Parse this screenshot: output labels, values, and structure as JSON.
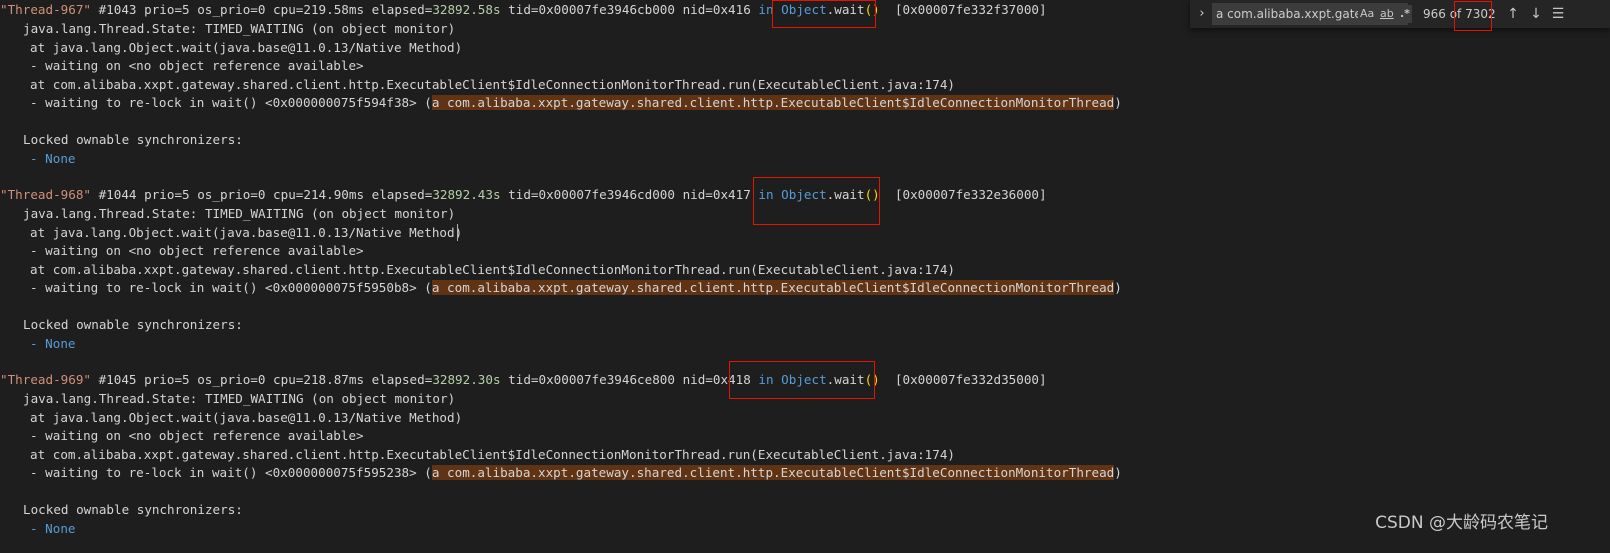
{
  "find_widget": {
    "query": "a com.alibaba.xxpt.gatew",
    "match_case_label": "Aa",
    "whole_word_label": "ab",
    "regex_label": ".*",
    "match_count": "966 of 7302",
    "toggle_icon": "chevron-right-icon",
    "prev_icon": "arrow-up-icon",
    "next_icon": "arrow-down-icon",
    "selection_icon": "find-in-selection-icon"
  },
  "watermark": "CSDN @大龄码农笔记",
  "colors": {
    "background": "#1e1e1e",
    "text": "#d4d4d4",
    "string": "#ce9178",
    "keyword": "#569cd6",
    "number": "#b5cea8",
    "paren": "#ffd700",
    "find_highlight": "#613315",
    "annotation_box": "#e51400"
  },
  "threads": [
    {
      "name": "\"Thread-967\"",
      "num": "#1043",
      "prio": "prio=5",
      "os_prio": "os_prio=0",
      "cpu": "cpu=219.58ms",
      "elapsed_label": "elapsed=",
      "elapsed_value": "32892.58s",
      "tid": "tid=0x00007fe3946cb000",
      "nid": "nid=0x416",
      "in_kw": "in",
      "wait_obj": "Object",
      "wait_fn": ".wait",
      "wait_parens": "()",
      "address": "[0x00007fe332f37000]",
      "state": "java.lang.Thread.State: TIMED_WAITING (on object monitor)",
      "frame1": "at java.lang.Object.wait(java.base@11.0.13/Native Method)",
      "waiting_on": "- waiting on <no object reference available>",
      "frame2": "at com.alibaba.xxpt.gateway.shared.client.http.ExecutableClient$IdleConnectionMonitorThread.run(ExecutableClient.java:174)",
      "relock_prefix": "- waiting to re-lock in wait() <0x000000075f594f38> (",
      "relock_match": "a com.alibaba.xxpt.gateway.shared.client.http.ExecutableClient$IdleConnectionMonitorThread",
      "relock_suffix": ")",
      "sync_header": "Locked ownable synchronizers:",
      "sync_none": "- None"
    },
    {
      "name": "\"Thread-968\"",
      "num": "#1044",
      "prio": "prio=5",
      "os_prio": "os_prio=0",
      "cpu": "cpu=214.90ms",
      "elapsed_label": "elapsed=",
      "elapsed_value": "32892.43s",
      "tid": "tid=0x00007fe3946cd000",
      "nid": "nid=0x417",
      "in_kw": "in",
      "wait_obj": "Object",
      "wait_fn": ".wait",
      "wait_parens": "()",
      "address": "[0x00007fe332e36000]",
      "state": "java.lang.Thread.State: TIMED_WAITING (on object monitor)",
      "frame1": "at java.lang.Object.wait(java.base@11.0.13/Native Method)",
      "waiting_on": "- waiting on <no object reference available>",
      "frame2": "at com.alibaba.xxpt.gateway.shared.client.http.ExecutableClient$IdleConnectionMonitorThread.run(ExecutableClient.java:174)",
      "relock_prefix": "- waiting to re-lock in wait() <0x000000075f5950b8> (",
      "relock_match": "a com.alibaba.xxpt.gateway.shared.client.http.ExecutableClient$IdleConnectionMonitorThread",
      "relock_suffix": ")",
      "sync_header": "Locked ownable synchronizers:",
      "sync_none": "- None"
    },
    {
      "name": "\"Thread-969\"",
      "num": "#1045",
      "prio": "prio=5",
      "os_prio": "os_prio=0",
      "cpu": "cpu=218.87ms",
      "elapsed_label": "elapsed=",
      "elapsed_value": "32892.30s",
      "tid": "tid=0x00007fe3946ce800",
      "nid": "nid=0x418",
      "in_kw": "in",
      "wait_obj": "Object",
      "wait_fn": ".wait",
      "wait_parens": "()",
      "address": "[0x00007fe332d35000]",
      "state": "java.lang.Thread.State: TIMED_WAITING (on object monitor)",
      "frame1": "at java.lang.Object.wait(java.base@11.0.13/Native Method)",
      "waiting_on": "- waiting on <no object reference available>",
      "frame2": "at com.alibaba.xxpt.gateway.shared.client.http.ExecutableClient$IdleConnectionMonitorThread.run(ExecutableClient.java:174)",
      "relock_prefix": "- waiting to re-lock in wait() <0x000000075f595238> (",
      "relock_match": "a com.alibaba.xxpt.gateway.shared.client.http.ExecutableClient$IdleConnectionMonitorThread",
      "relock_suffix": ")",
      "sync_header": "Locked ownable synchronizers:",
      "sync_none": "- None"
    }
  ]
}
